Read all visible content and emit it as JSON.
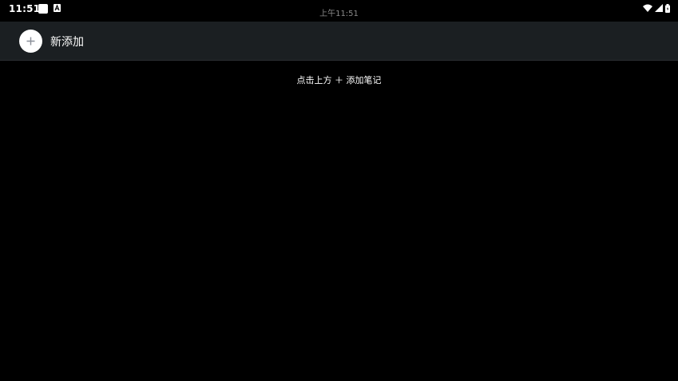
{
  "status_bar": {
    "time": "11:51",
    "center_time": "上午11:51",
    "icons_left": [
      "note-icon",
      "a-icon"
    ],
    "icons_right": [
      "wifi-icon",
      "signal-icon",
      "battery-icon"
    ]
  },
  "toolbar": {
    "add_label": "新添加",
    "add_icon": "plus-icon"
  },
  "main": {
    "hint": "点击上方 ＋ 添加笔记"
  },
  "colors": {
    "background": "#000000",
    "toolbar": "#1b1f22",
    "plus": "#8a8f99"
  }
}
